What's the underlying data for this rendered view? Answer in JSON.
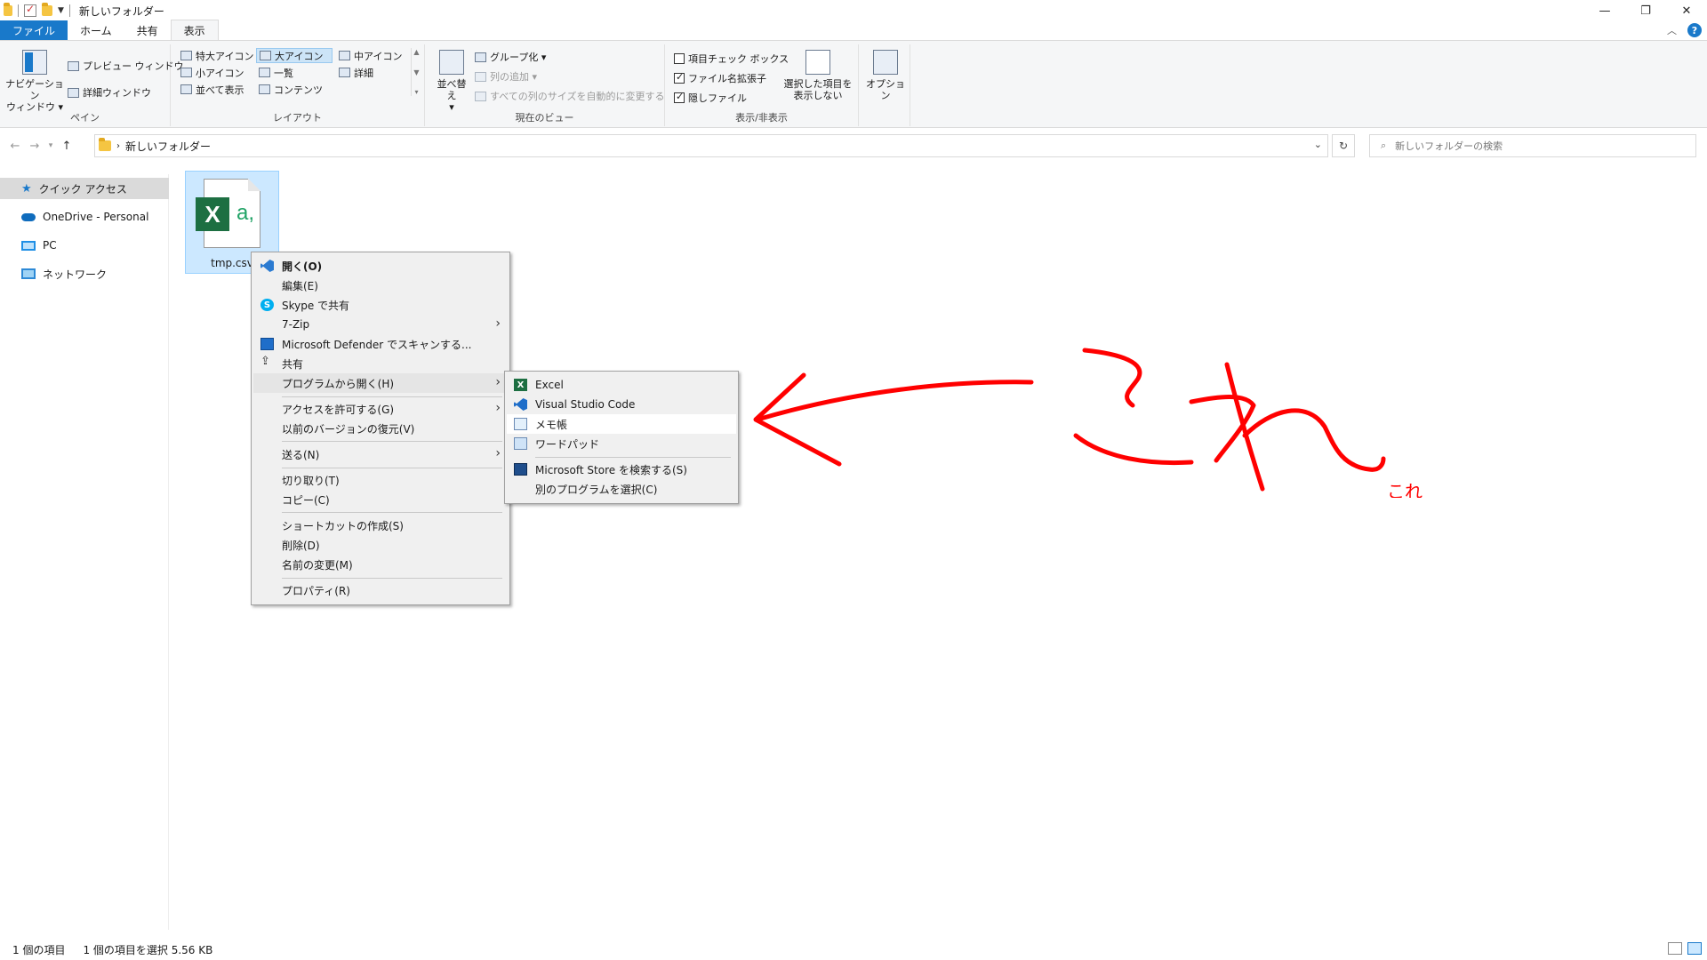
{
  "window": {
    "title": "新しいフォルダー",
    "controls": {
      "minimize": "—",
      "restore": "❐",
      "close": "✕"
    }
  },
  "ribbon_tabs": [
    {
      "label": "ファイル"
    },
    {
      "label": "ホーム"
    },
    {
      "label": "共有"
    },
    {
      "label": "表示"
    }
  ],
  "ribbon": {
    "pane": {
      "label": "ペイン",
      "nav_pane": "ナビゲーション\nウィンドウ ▾",
      "nav_pane_l1": "ナビゲーション",
      "nav_pane_l2": "ウィンドウ ▾",
      "preview": "プレビュー ウィンドウ",
      "details": "詳細ウィンドウ"
    },
    "layout": {
      "label": "レイアウト",
      "items": [
        "特大アイコン",
        "大アイコン",
        "中アイコン",
        "小アイコン",
        "一覧",
        "詳細",
        "並べて表示",
        "コンテンツ"
      ],
      "selected": "大アイコン"
    },
    "current_view": {
      "label": "現在のビュー",
      "sort_l1": "並べ替え",
      "sort_l2": "▾",
      "group": "グループ化 ▾",
      "add_column": "列の追加 ▾",
      "fit_columns": "すべての列のサイズを自動的に変更する"
    },
    "show_hide": {
      "label": "表示/非表示",
      "item_checkbox": "項目チェック ボックス",
      "file_ext": "ファイル名拡張子",
      "hidden": "隠しファイル",
      "hide_selected_l1": "選択した項目を",
      "hide_selected_l2": "表示しない",
      "item_checkbox_checked": false,
      "file_ext_checked": true,
      "hidden_checked": true
    },
    "options": "オプション"
  },
  "address_bar": {
    "path": "新しいフォルダー",
    "search_placeholder": "新しいフォルダーの検索"
  },
  "sidebar": {
    "items": [
      {
        "label": "クイック アクセス"
      },
      {
        "label": "OneDrive - Personal"
      },
      {
        "label": "PC"
      },
      {
        "label": "ネットワーク"
      }
    ]
  },
  "file": {
    "name": "tmp.csv"
  },
  "context_menu": {
    "items": [
      "開く(O)",
      "編集(E)",
      "Skype で共有",
      "7-Zip",
      "Microsoft Defender でスキャンする...",
      "共有",
      "プログラムから開く(H)",
      "アクセスを許可する(G)",
      "以前のバージョンの復元(V)",
      "送る(N)",
      "切り取り(T)",
      "コピー(C)",
      "ショートカットの作成(S)",
      "削除(D)",
      "名前の変更(M)",
      "プロパティ(R)"
    ]
  },
  "open_with_menu": {
    "items": [
      "Excel",
      "Visual Studio Code",
      "メモ帳",
      "ワードパッド",
      "Microsoft Store を検索する(S)",
      "別のプログラムを選択(C)"
    ]
  },
  "status_bar": {
    "item_count": "1 個の項目",
    "selection": "1 個の項目を選択  5.56 KB"
  },
  "annotation": {
    "text": "これ",
    "color": "#ff0000"
  }
}
